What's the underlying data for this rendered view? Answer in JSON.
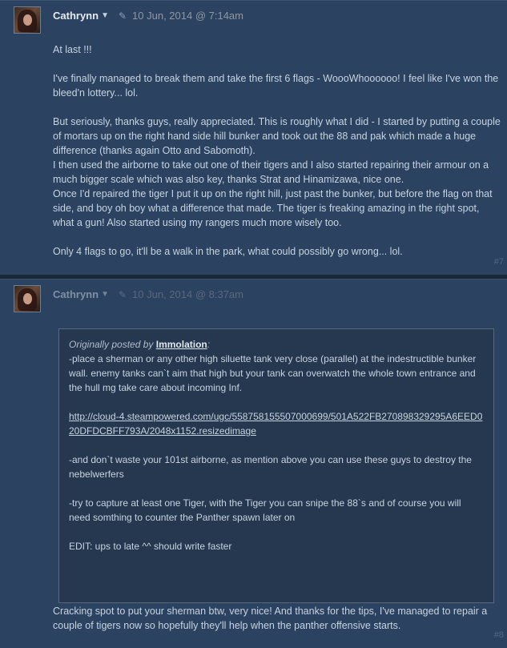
{
  "posts": [
    {
      "author": "Cathrynn",
      "date": "10 Jun, 2014 @ 7:14am",
      "number": "#7",
      "paragraphs": [
        "At last !!!",
        "I've finally managed to break them and take the first 6 flags - WoooWhoooooo! I feel like I've won the bleed'n lottery... lol.",
        "But seriously, thanks guys, really appreciated. This is roughly what I did - I started by putting a couple of mortars up on the right hand side hill bunker and took out the 88 and pak which made a huge difference (thanks again Otto and Sabomoth).",
        "I then used the airborne to take out one of their tigers and I also started repairing their armour on a much bigger scale which was also key, thanks Strat and Hinamizawa, nice one.",
        "Once I'd repaired the tiger I put it up on the right hill, just past the bunker, but before the flag on that side, and boy oh boy what a difference that made. The tiger is freaking amazing in the right spot, what a gun! Also started using my rangers much more wisely too.",
        "Only 4 flags to go, it'll be a walk in the park, what could possibly go wrong... lol."
      ]
    },
    {
      "author": "Cathrynn",
      "date": "10 Jun, 2014 @ 8:37am",
      "number": "#8",
      "quote": {
        "origin_prefix": "Originally posted by",
        "origin_author": "Immolation",
        "origin_suffix": ":",
        "line1": "-place a sherman or any other high siluette tank very close (parallel) at the indestructible bunker wall. enemy tanks can`t aim that high but your tank can overwatch the whole town entrance and the hull mg take care about incoming Inf.",
        "link": "http://cloud-4.steampowered.com/ugc/558758155507000699/501A522FB270898329295A6EED020DFDCBFF793A/2048x1152.resizedimage",
        "line2": "-and don`t waste your 101st airborne, as mention above you can use these guys to destroy the nebelwerfers",
        "line3": "-try to capture at least one Tiger, with the Tiger you can snipe the 88`s and of course you will need somthing to counter the Panther spawn later on",
        "line4": "EDIT: ups to late ^^ should write faster"
      },
      "reply": "Cracking spot to put your sherman btw, very nice! And thanks for the tips, I've managed to repair a couple of tigers now so hopefully they'll help when the panther offensive starts."
    }
  ],
  "colors": {
    "background": "#1b2838",
    "post_background": "#2c4261",
    "text": "#c6d4df"
  }
}
